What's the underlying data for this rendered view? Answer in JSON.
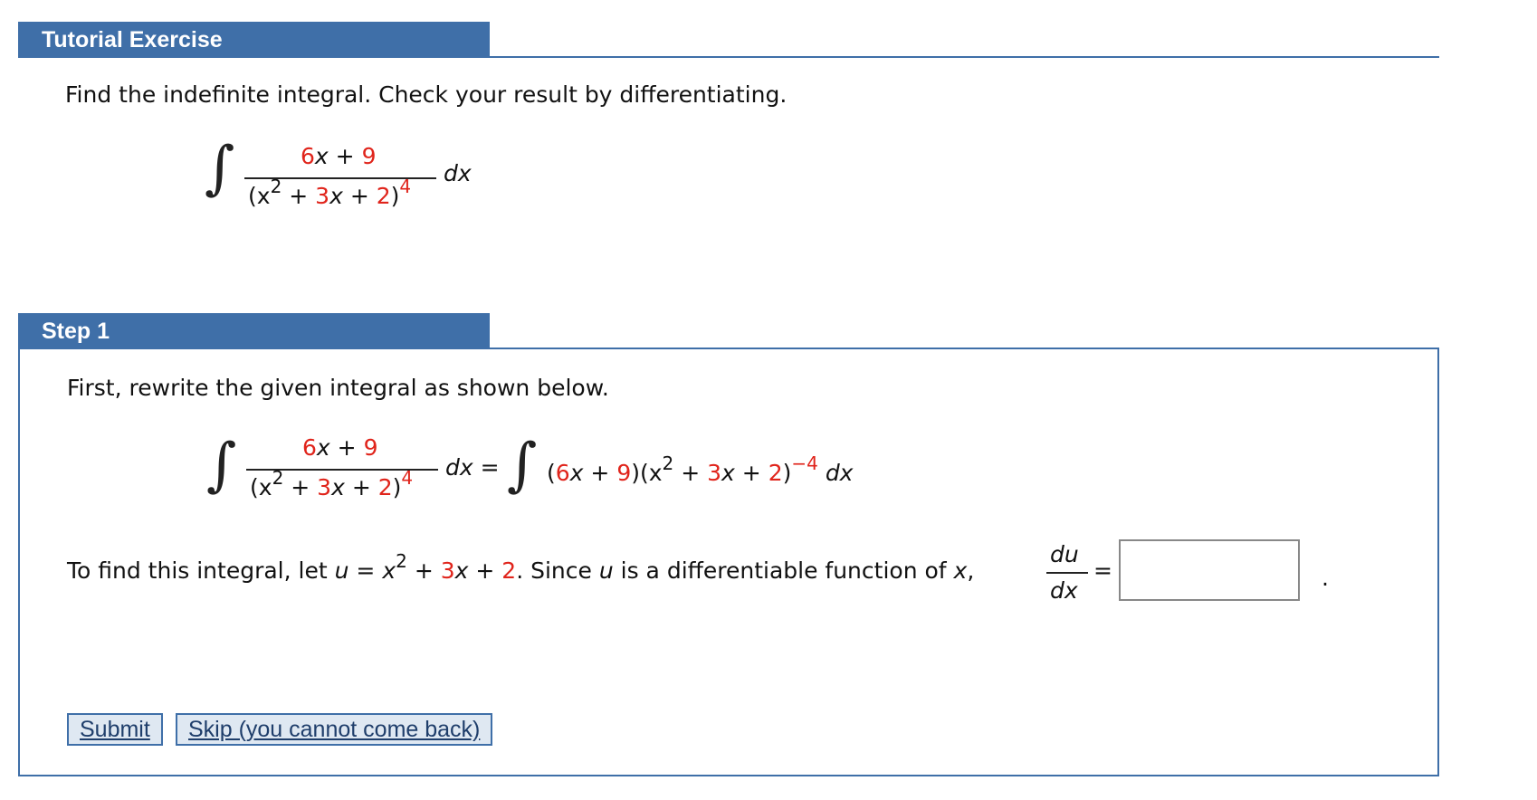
{
  "tutorial": {
    "header": "Tutorial Exercise",
    "prompt": "Find the indefinite integral. Check your result by differentiating.",
    "integral": {
      "num_coef": "6",
      "num_var": "x",
      "num_op": "+",
      "num_const": "9",
      "den_open": "(x",
      "den_exp": "2",
      "den_op1": "+",
      "den_coef": "3",
      "den_var": "x",
      "den_op2": "+",
      "den_const": "2",
      "den_close": ")",
      "den_power": "4",
      "dx": "dx"
    }
  },
  "step": {
    "header": "Step 1",
    "intro": "First, rewrite the given integral as shown below.",
    "equals": "=",
    "rewritten": {
      "open": "(",
      "coef": "6",
      "var": "x",
      "op1": "+",
      "const": "9",
      "mid": ")(x",
      "exp": "2",
      "op2": "+",
      "coef2": "3",
      "var2": "x",
      "op3": "+",
      "const2": "2",
      "close": ")",
      "power": "−4",
      "dx": "dx"
    },
    "sentence": {
      "part1": "To find this integral, let",
      "u": "u",
      "eq": "=",
      "x2": "x",
      "x2_exp": "2",
      "plus1": "+",
      "coef": "3",
      "x": "x",
      "plus2": "+",
      "const": "2",
      "part2": ". Since",
      "u2": "u",
      "part3": "is a differentiable function of",
      "x3": "x",
      "comma": ","
    },
    "du": "du",
    "dx": "dx",
    "equals2": "=",
    "answer_value": "",
    "period": "."
  },
  "buttons": {
    "submit": "Submit",
    "skip": "Skip (you cannot come back)"
  }
}
